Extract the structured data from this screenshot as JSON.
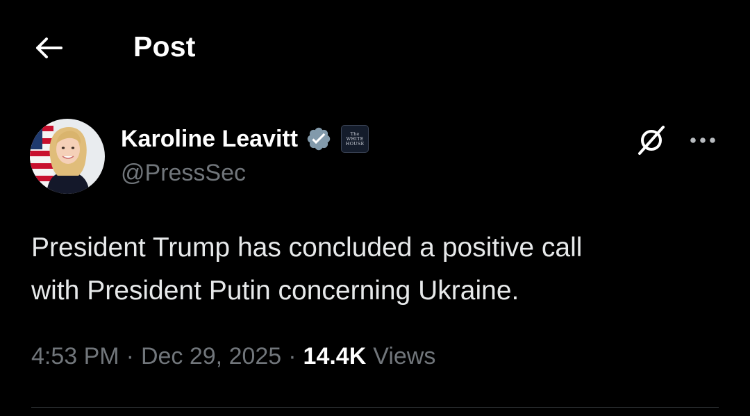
{
  "header": {
    "back_icon": "arrow-left-icon",
    "title": "Post"
  },
  "author": {
    "display_name": "Karoline Leavitt",
    "handle": "@PressSec",
    "verified_icon": "verified-badge-icon",
    "verified_color": "#829aab",
    "affiliation_badge_lines": [
      "The",
      "WHITE",
      "HOUSE"
    ],
    "avatar_icon": "profile-photo"
  },
  "actions": {
    "grok_icon": "grok-icon",
    "more_icon": "more-horizontal-icon"
  },
  "post": {
    "text": "President Trump has concluded a positive call\nwith President Putin concerning Ukraine.",
    "time": "4:53 PM",
    "separator": "·",
    "date": "Dec 29, 2025",
    "views_count": "14.4K",
    "views_label": "Views"
  },
  "colors": {
    "background": "#000000",
    "primary_text": "#e7e9ea",
    "secondary_text": "#71767b",
    "divider": "#2f3336"
  }
}
